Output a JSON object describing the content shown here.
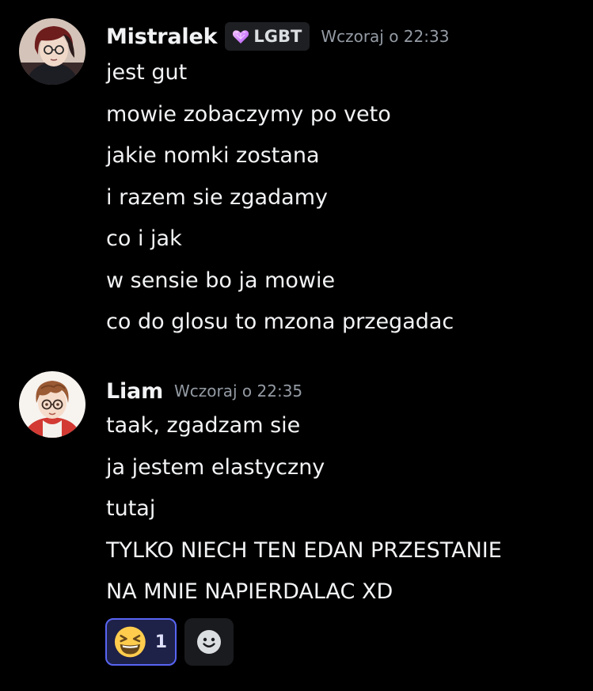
{
  "messages": [
    {
      "author": "Mistralek",
      "tag": {
        "icon": "heart-gem-icon",
        "label": "LGBT"
      },
      "timestamp": "Wczoraj o 22:33",
      "lines": [
        "jest gut",
        "mowie zobaczymy po veto",
        "jakie nomki zostana",
        "i razem sie zgadamy",
        "co i jak",
        "w sensie bo ja mowie",
        "co do glosu to mzona przegadac"
      ]
    },
    {
      "author": "Liam",
      "timestamp": "Wczoraj o 22:35",
      "lines": [
        "taak, zgadzam sie",
        "ja jestem elastyczny",
        "tutaj",
        "TYLKO NIECH TEN EDAN PRZESTANIE",
        "NA MNIE NAPIERDALAC XD"
      ],
      "reactions": [
        {
          "icon": "laughing-emoji-icon",
          "count": "1",
          "reacted": true
        }
      ],
      "add_reaction_icon": "add-reaction-icon"
    }
  ],
  "colors": {
    "background": "#000000",
    "text": "#f2f3f5",
    "timestamp": "#949ba4",
    "accent": "#5865f2",
    "tag_background": "#1e1f22"
  }
}
